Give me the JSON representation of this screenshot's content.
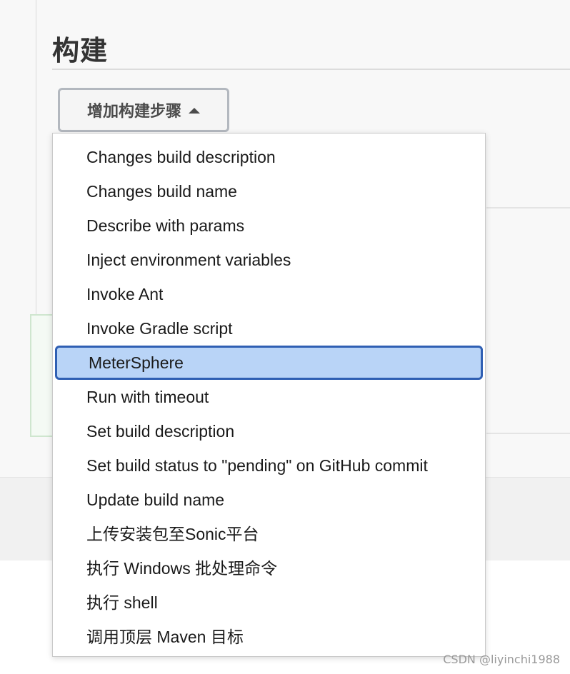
{
  "section": {
    "title": "构建"
  },
  "add_step_button": {
    "label": "增加构建步骤"
  },
  "dropdown": {
    "items": [
      {
        "label": "Changes build description"
      },
      {
        "label": "Changes build name"
      },
      {
        "label": "Describe with params"
      },
      {
        "label": "Inject environment variables"
      },
      {
        "label": "Invoke Ant"
      },
      {
        "label": "Invoke Gradle script"
      },
      {
        "label": "MeterSphere",
        "selected": true
      },
      {
        "label": "Run with timeout"
      },
      {
        "label": "Set build description"
      },
      {
        "label": "Set build status to \"pending\" on GitHub commit"
      },
      {
        "label": "Update build name"
      },
      {
        "label": "上传安装包至Sonic平台"
      },
      {
        "label": "执行 Windows 批处理命令"
      },
      {
        "label": "执行 shell"
      },
      {
        "label": "调用顶层 Maven 目标"
      }
    ]
  },
  "watermark": "CSDN @liyinchi1988",
  "colors": {
    "selected_bg": "#b9d4f7",
    "selected_border": "#2f5fb3",
    "page_bg": "#f8f8f8"
  },
  "icons": {
    "button_caret": "caret-up-icon"
  }
}
